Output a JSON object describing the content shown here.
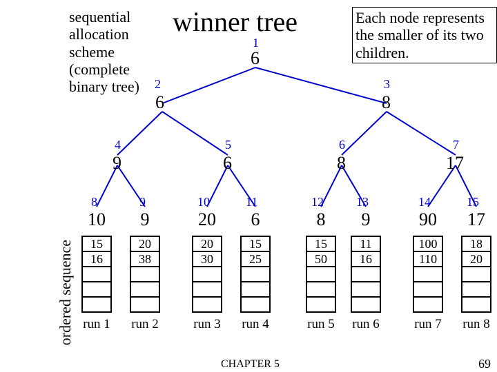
{
  "title": "winner tree",
  "note_left": "sequential allocation scheme (complete binary tree)",
  "note_right": "Each node represents the smaller of its two children.",
  "side_label": "ordered sequence",
  "footer": "CHAPTER 5",
  "page": "69",
  "runs": [
    {
      "idx": "8",
      "top": "10",
      "cells": [
        "15",
        "16",
        "",
        "",
        ""
      ],
      "label": "run 1"
    },
    {
      "idx": "9",
      "top": "9",
      "cells": [
        "20",
        "38",
        "",
        "",
        ""
      ],
      "label": "run 2"
    },
    {
      "idx": "10",
      "top": "20",
      "cells": [
        "20",
        "30",
        "",
        "",
        ""
      ],
      "label": "run 3"
    },
    {
      "idx": "11",
      "top": "6",
      "cells": [
        "15",
        "25",
        "",
        "",
        ""
      ],
      "label": "run 4"
    },
    {
      "idx": "12",
      "top": "8",
      "cells": [
        "15",
        "50",
        "",
        "",
        ""
      ],
      "label": "run 5"
    },
    {
      "idx": "13",
      "top": "9",
      "cells": [
        "11",
        "16",
        "",
        "",
        ""
      ],
      "label": "run 6"
    },
    {
      "idx": "14",
      "top": "90",
      "cells": [
        "100",
        "110",
        "",
        "",
        ""
      ],
      "label": "run 7"
    },
    {
      "idx": "15",
      "top": "17",
      "cells": [
        "18",
        "20",
        "",
        "",
        ""
      ],
      "label": "run 8"
    }
  ],
  "nodes": {
    "n1": {
      "idx": "1",
      "val": "6"
    },
    "n2": {
      "idx": "2",
      "val": "6"
    },
    "n3": {
      "idx": "3",
      "val": "8"
    },
    "n4": {
      "idx": "4",
      "val": "9"
    },
    "n5": {
      "idx": "5",
      "val": "6"
    },
    "n6": {
      "idx": "6",
      "val": "8"
    },
    "n7": {
      "idx": "7",
      "val": "17"
    }
  },
  "chart_data": {
    "type": "tree",
    "description": "Winner (tournament) tree over 8 sorted runs; each internal node holds the smaller of its two children.",
    "internal_node_values_by_index": {
      "1": 6,
      "2": 6,
      "3": 8,
      "4": 9,
      "5": 6,
      "6": 8,
      "7": 17
    },
    "leaf_node_values_by_index": {
      "8": 10,
      "9": 9,
      "10": 20,
      "11": 6,
      "12": 8,
      "13": 9,
      "14": 90,
      "15": 17
    },
    "runs": [
      {
        "name": "run 1",
        "values": [
          15,
          16
        ]
      },
      {
        "name": "run 2",
        "values": [
          20,
          38
        ]
      },
      {
        "name": "run 3",
        "values": [
          20,
          30
        ]
      },
      {
        "name": "run 4",
        "values": [
          15,
          25
        ]
      },
      {
        "name": "run 5",
        "values": [
          15,
          50
        ]
      },
      {
        "name": "run 6",
        "values": [
          11,
          16
        ]
      },
      {
        "name": "run 7",
        "values": [
          100,
          110
        ]
      },
      {
        "name": "run 8",
        "values": [
          18,
          20
        ]
      }
    ]
  }
}
